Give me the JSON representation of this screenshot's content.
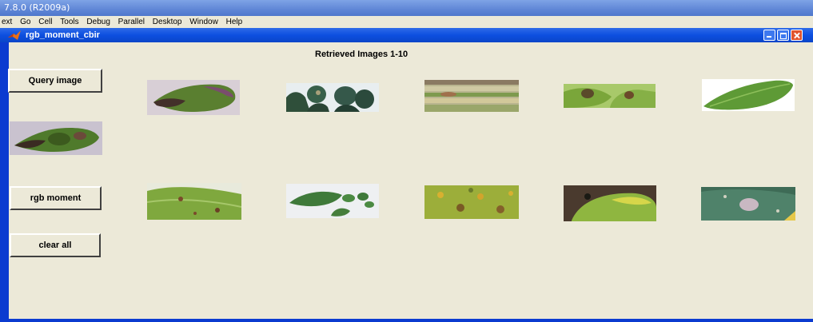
{
  "outer_window": {
    "title": "7.8.0 (R2009a)"
  },
  "menubar": {
    "items": [
      "ext",
      "Go",
      "Cell",
      "Tools",
      "Debug",
      "Parallel",
      "Desktop",
      "Window",
      "Help"
    ]
  },
  "figure_window": {
    "title": "rgb_moment_cbir",
    "icon": "matlab-logo-icon",
    "controls": [
      "minimize-icon",
      "maximize-icon",
      "close-icon"
    ]
  },
  "main": {
    "heading": "Retrieved Images 1-10",
    "buttons": {
      "query": "Query image",
      "rgb": "rgb moment",
      "clear": "clear all"
    },
    "query_image": {
      "description": "leaf with dark lesions"
    },
    "retrieved": [
      {
        "index": 1,
        "description": "green leaf with purple edge"
      },
      {
        "index": 2,
        "description": "dark leaves clusters"
      },
      {
        "index": 3,
        "description": "striped pale leaf"
      },
      {
        "index": 4,
        "description": "leaves with brown spots"
      },
      {
        "index": 5,
        "description": "bright green leaf"
      },
      {
        "index": 6,
        "description": "leaf with brown spots"
      },
      {
        "index": 7,
        "description": "leaves on white background"
      },
      {
        "index": 8,
        "description": "yellow spotted leaf"
      },
      {
        "index": 9,
        "description": "yellowing leaf on soil"
      },
      {
        "index": 10,
        "description": "blue-green leaf with pale spot"
      }
    ]
  },
  "colors": {
    "title_bar": "#0a45c8",
    "client_bg": "#ece9d8",
    "close_button": "#e0542e"
  }
}
